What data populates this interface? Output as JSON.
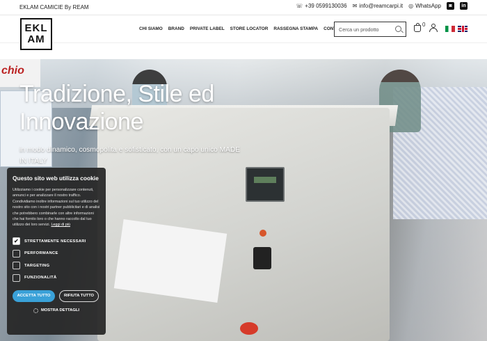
{
  "topbar": {
    "brand_line": "EKLAM CAMICIE By REAM",
    "phone": "+39 0599130036",
    "email": "info@reamcarpi.it",
    "whatsapp": "WhatsApp"
  },
  "header": {
    "logo_line1": "EKL",
    "logo_line2": "AM",
    "nav": [
      "CHI SIAMO",
      "BRAND",
      "PRIVATE LABEL",
      "STORE LOCATOR",
      "RASSEGNA STAMPA",
      "CONTATTI"
    ],
    "search_placeholder": "Cerca un prodotto",
    "cart_count": "0"
  },
  "hero": {
    "title": "Tradizione, Stile ed Innovazione",
    "subtitle": "in modo dinamico, cosmopolita e sofisticato, con un capo unico MADE IN ITALY",
    "sign_text": "chio"
  },
  "cookie": {
    "title": "Questo sito web utilizza cookie",
    "body": "Utilizziamo i cookie per personalizzare contenuti, annunci e per analizzare il nostro traffico. Condividiamo inoltre informazioni sul tuo utilizzo del nostro sito con i nostri partner pubblicitari e di analisi che potrebbero combinarle con altre informazioni che hai fornito loro o che hanno raccolto dal tuo utilizzo dei loro servizi.",
    "read_more": "Leggi di più",
    "options": [
      {
        "label": "STRETTAMENTE NECESSARI",
        "checked": true
      },
      {
        "label": "PERFORMANCE",
        "checked": false
      },
      {
        "label": "TARGETING",
        "checked": false
      },
      {
        "label": "FUNZIONALITÀ",
        "checked": false
      }
    ],
    "accept_label": "ACCETTA TUTTO",
    "reject_label": "RIFIUTA TUTTO",
    "details_label": "MOSTRA DETTAGLI"
  }
}
